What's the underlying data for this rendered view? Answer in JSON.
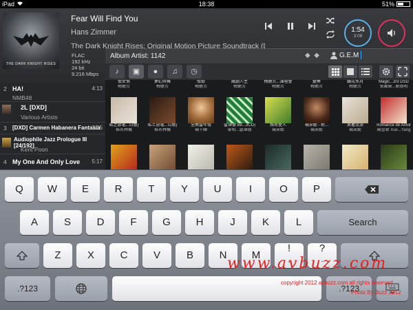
{
  "status": {
    "device": "iPad",
    "time": "18:38",
    "battery": "51%",
    "battery_level": 0.51
  },
  "now_playing": {
    "title": "Fear Will Find You",
    "artist": "Hans Zimmer",
    "album": "The Dark Knight Rises: Original Motion Picture Soundtrack (Deluxe...",
    "format": "FLAC",
    "sample_rate": "192 kHz",
    "bit_depth": "24 bit",
    "bitrate": "9.216 Mbps",
    "elapsed": "1:54",
    "total": "3:08",
    "cover_text": "THE DARK KNIGHT RISES"
  },
  "album_artist_bar": {
    "label": "Album Artist: 1142",
    "search_value": "G.E.M"
  },
  "left_list": [
    {
      "num": "2",
      "title": "HA!",
      "subtitle": "NMB48",
      "duration": "4:13"
    },
    {
      "num": "",
      "title": "2L [DXD]",
      "subtitle": "Various Artists",
      "duration": ""
    },
    {
      "num": "3",
      "title": "[DXD] Carmen Habanera Fantasia",
      "subtitle": "",
      "duration": "3:15"
    },
    {
      "num": "",
      "title": "Audiophile Jazz Prologue III [24/192]",
      "subtitle": "Kent Poon",
      "duration": ""
    },
    {
      "num": "4",
      "title": "My One And Only Love",
      "subtitle": "",
      "duration": "5:17"
    }
  ],
  "grid": {
    "row1": [
      {
        "name": "懷女恨",
        "artist": "梅艷芳"
      },
      {
        "name": "夢幻共舞",
        "artist": "梅艷芳"
      },
      {
        "name": "情歌",
        "artist": "梅艷芳"
      },
      {
        "name": "蔵劇人生",
        "artist": "梅艷芳"
      },
      {
        "name": "梅艷芳...演唱會",
        "artist": "梅艷芳"
      },
      {
        "name": "變奏",
        "artist": "梅艷芳"
      },
      {
        "name": "鏡花水月",
        "artist": "梅艷芳"
      },
      {
        "name": "Magic...3/3 DSD",
        "artist": "張國榮...劉德明"
      }
    ],
    "row2": [
      {
        "name": "私之旅電...日版)",
        "artist": "椎名林檎"
      },
      {
        "name": "私と放電...日版)",
        "artist": "椎名林檎"
      },
      {
        "name": "全曲當年情",
        "artist": "楊千嬅"
      },
      {
        "name": "雷頌德 Be...3CD)",
        "artist": "黎明...雷頌德"
      },
      {
        "name": "親密愛人",
        "artist": "楊采妮"
      },
      {
        "name": "楊采妮 - 新...",
        "artist": "楊采妮"
      },
      {
        "name": "笑著流淚",
        "artist": "楊采妮"
      },
      {
        "name": "Romance de Amor",
        "artist": "楊雪霏 Xue...Yang"
      }
    ]
  },
  "keyboard": {
    "row1": [
      "Q",
      "W",
      "E",
      "R",
      "T",
      "Y",
      "U",
      "I",
      "O",
      "P"
    ],
    "row2": [
      "A",
      "S",
      "D",
      "F",
      "G",
      "H",
      "J",
      "K",
      "L"
    ],
    "row3": [
      "Z",
      "X",
      "C",
      "V",
      "B",
      "N",
      "M",
      "!",
      ",",
      "?"
    ],
    "row3_sub": [
      ",",
      "."
    ],
    "search_label": "Search",
    "numbers_label": ".?123"
  },
  "watermark": {
    "site": "www.avbuzz.com",
    "copyright": "copyright 2012 avbuzz.com all rights reserved",
    "photo": "Photo By Buzz 2012"
  },
  "colors": {
    "time_ring": "#5ab3e8",
    "volume_ring": "#e2325e",
    "watermark": "#e22222"
  }
}
